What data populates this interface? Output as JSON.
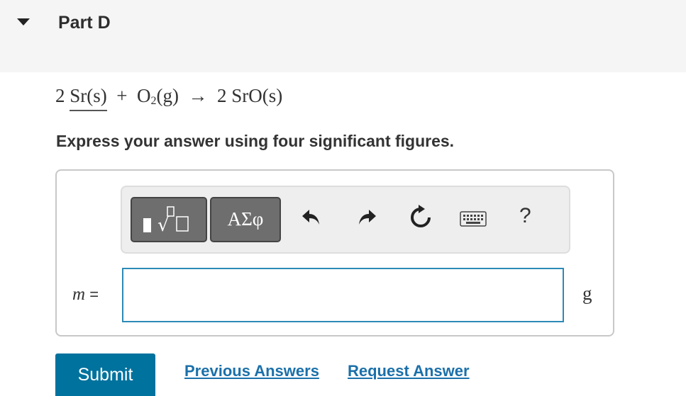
{
  "part": {
    "title": "Part D"
  },
  "equation": {
    "coef1": "2",
    "reactant1": "Sr(s)",
    "plus": "+",
    "o2_symbol": "O",
    "o2_sub": "2",
    "o2_state": "(g)",
    "arrow": "→",
    "coef2": "2",
    "product": "SrO(s)"
  },
  "instruction": "Express your answer using four significant figures.",
  "toolbar": {
    "symbols_label": "ΑΣφ",
    "help_label": "?"
  },
  "answer": {
    "variable": "m",
    "equals": "=",
    "value": "",
    "unit": "g"
  },
  "actions": {
    "submit_label": "Submit",
    "previous_answers_label": "Previous Answers",
    "request_answer_label": "Request Answer"
  },
  "colors": {
    "accent": "#00729e",
    "link": "#1b70aa",
    "input_border": "#2d8ab7",
    "header_bg": "#f5f5f5"
  }
}
